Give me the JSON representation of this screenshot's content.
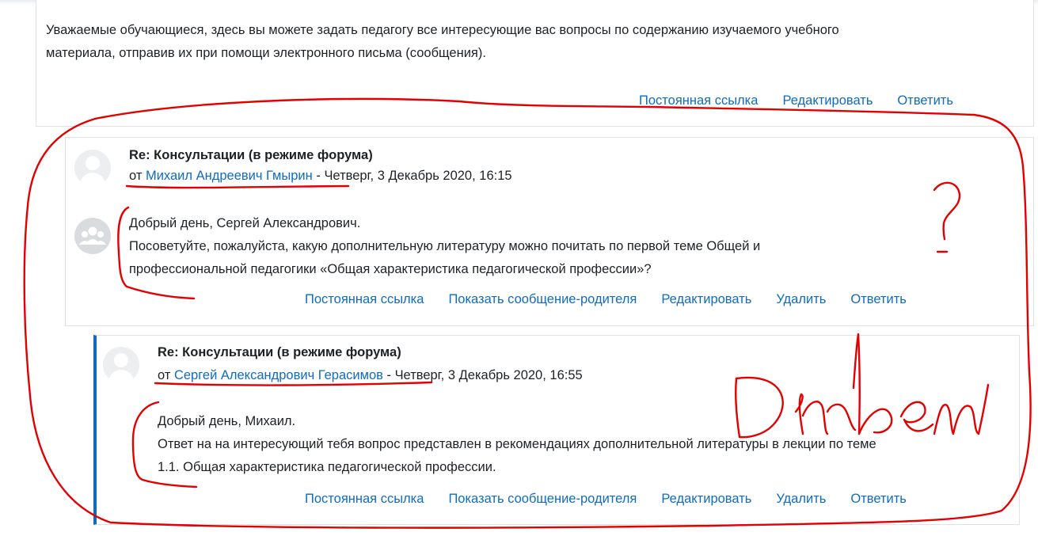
{
  "intro": {
    "text_line1": "Уважаемые обучающиеся, здесь вы можете задать педагогу все интересующие вас вопросы по содержанию изучаемого учебного",
    "text_line2": "материала, отправив их при помощи электронного письма (сообщения).",
    "actions": [
      "Постоянная ссылка",
      "Редактировать",
      "Ответить"
    ]
  },
  "posts": [
    {
      "subject": "Re: Консультации (в режиме форума)",
      "by": "от",
      "author": "Михаил Андреевич Гмырин",
      "date": "- Четверг, 3 Декабрь 2020, 16:15",
      "lines": [
        "Добрый день, Сергей Александрович.",
        "Посоветуйте, пожалуйста, какую дополнительную литературу можно почитать по первой теме Общей и",
        "профессиональной педагогики «Общая характеристика педагогической профессии»?"
      ],
      "actions": [
        "Постоянная ссылка",
        "Показать сообщение-родителя",
        "Редактировать",
        "Удалить",
        "Ответить"
      ]
    },
    {
      "subject": "Re: Консультации (в режиме форума)",
      "by": "от",
      "author": "Сергей Александрович Герасимов",
      "date": "- Четверг, 3 Декабрь 2020, 16:55",
      "lines": [
        "Добрый день, Михаил.",
        "Ответ на на интересующий тебя вопрос представлен в рекомендациях дополнительной литературы в лекции по теме",
        "1.1. Общая характеристика педагогической профессии."
      ],
      "actions": [
        "Постоянная ссылка",
        "Показать сообщение-родителя",
        "Редактировать",
        "Удалить",
        "Ответить"
      ]
    }
  ],
  "colors": {
    "link": "#0f6cbf",
    "annotation": "#e30000",
    "thread_border": "#0f6cbf"
  },
  "icons": [
    "user-avatar-icon",
    "group-icon"
  ]
}
